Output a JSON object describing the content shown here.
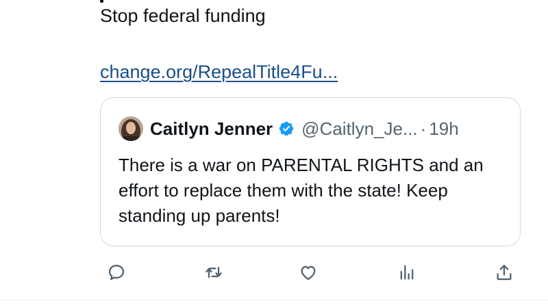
{
  "post": {
    "text": "Stop federal funding",
    "link": "change.org/RepealTitle4Fu..."
  },
  "quote": {
    "name": "Caitlyn Jenner",
    "handle": "@Caitlyn_Je...",
    "separator": "·",
    "time": "19h",
    "verified": true,
    "text": "There is a war on PARENTAL RIGHTS and an effort to replace them with the state! Keep standing up parents!"
  },
  "actions": [
    {
      "name": "reply",
      "icon": "speech-bubble-icon"
    },
    {
      "name": "repost",
      "icon": "repost-arrows-icon"
    },
    {
      "name": "like",
      "icon": "heart-icon"
    },
    {
      "name": "views",
      "icon": "bar-chart-icon"
    },
    {
      "name": "share",
      "icon": "share-upload-icon"
    }
  ],
  "colors": {
    "text": "#0f1419",
    "secondary": "#536471",
    "link": "#1a4e8a",
    "verified": "#1d9bf0",
    "border": "#cfd9de"
  }
}
